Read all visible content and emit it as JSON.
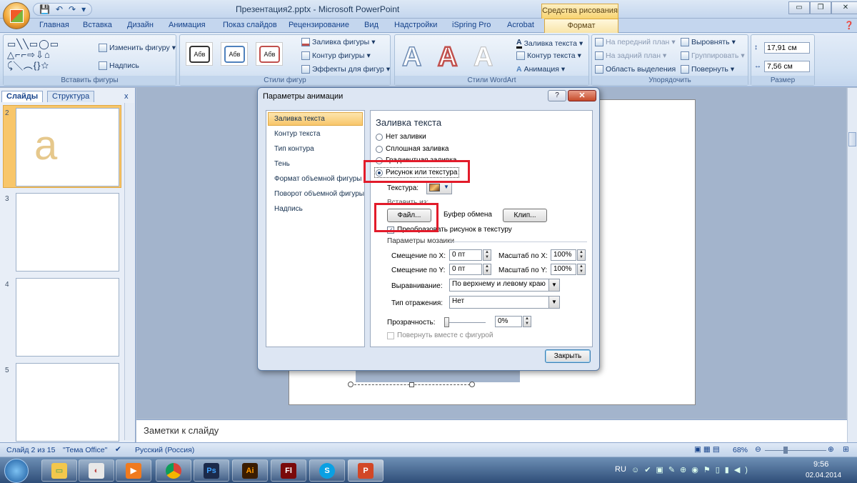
{
  "window": {
    "title": "Презентация2.pptx - Microsoft PowerPoint",
    "context_group": "Средства рисования",
    "controls": [
      "▭",
      "❐",
      "✕"
    ]
  },
  "qat": {
    "save": "💾",
    "undo": "↶",
    "redo": "↷",
    "more": "▾"
  },
  "ribbon_tabs": [
    "Главная",
    "Вставка",
    "Дизайн",
    "Анимация",
    "Показ слайдов",
    "Рецензирование",
    "Вид",
    "Надстройки",
    "iSpring Pro",
    "Acrobat"
  ],
  "active_tab": "Формат",
  "ribbon": {
    "insert_shapes": {
      "label": "Вставить фигуры",
      "change_shape": "Изменить фигуру",
      "text_box": "Надпись"
    },
    "shape_styles": {
      "label": "Стили фигур",
      "sample": "Абв",
      "fill": "Заливка фигуры",
      "outline": "Контур фигуры",
      "effects": "Эффекты для фигур"
    },
    "wordart": {
      "label": "Стили WordArt",
      "letter": "A",
      "text_fill": "Заливка текста",
      "text_outline": "Контур текста",
      "animation": "Анимация"
    },
    "arrange": {
      "label": "Упорядочить",
      "bring_front": "На передний план",
      "send_back": "На задний план",
      "selection_pane": "Область выделения",
      "align": "Выровнять",
      "group": "Группировать",
      "rotate": "Повернуть"
    },
    "size": {
      "label": "Размер",
      "height": "17,91 см",
      "width": "7,56 см"
    }
  },
  "left_panel": {
    "tabs": [
      "Слайды",
      "Структура"
    ],
    "close": "x",
    "slides": [
      {
        "num": "2",
        "content": "a"
      },
      {
        "num": "3",
        "content": ""
      },
      {
        "num": "4",
        "content": ""
      },
      {
        "num": "5",
        "content": ""
      }
    ]
  },
  "notes": {
    "placeholder": "Заметки к слайду"
  },
  "status": {
    "slide": "Слайд 2 из 15",
    "theme": "\"Тема Office\"",
    "language": "Русский (Россия)",
    "zoom": "68%"
  },
  "tray": {
    "lang": "RU",
    "time": "9:56",
    "date": "02.04.2014"
  },
  "taskbar": {
    "apps": [
      {
        "name": "ps",
        "text": "Ps",
        "color": "#1b2a4a",
        "fg": "#3fa2ff"
      },
      {
        "name": "ai",
        "text": "Ai",
        "color": "#3a1c00",
        "fg": "#ff9a00"
      },
      {
        "name": "flash",
        "text": "Fl",
        "color": "#7a0a0a",
        "fg": "#fff"
      },
      {
        "name": "skype",
        "text": "S",
        "color": "#0aa0e3",
        "fg": "#fff"
      },
      {
        "name": "ppt",
        "text": "P",
        "color": "#d24726",
        "fg": "#fff"
      }
    ]
  },
  "dialog": {
    "title": "Параметры анимации",
    "help": "?",
    "close": "✕",
    "nav": [
      "Заливка текста",
      "Контур текста",
      "Тип контура",
      "Тень",
      "Формат объемной фигуры",
      "Поворот объемной фигуры",
      "Надпись"
    ],
    "heading": "Заливка текста",
    "fill_options": [
      "Нет заливки",
      "Сплошная заливка",
      "Градиентная заливка",
      "Рисунок или текстура"
    ],
    "texture_label": "Текстура:",
    "insert_from": "Вставить из:",
    "file_btn": "Файл...",
    "clipboard_btn": "Буфер обмена",
    "clip_btn": "Клип...",
    "tile_check": "Преобразовать рисунок в текстуру",
    "tiling_header": "Параметры мозаики",
    "offset_x_label": "Смещение по X:",
    "offset_x": "0 пт",
    "offset_y_label": "Смещение по Y:",
    "offset_y": "0 пт",
    "scale_x_label": "Масштаб по X:",
    "scale_x": "100%",
    "scale_y_label": "Масштаб по Y:",
    "scale_y": "100%",
    "align_label": "Выравнивание:",
    "align_value": "По верхнему и левому краю",
    "mirror_label": "Тип отражения:",
    "mirror_value": "Нет",
    "transparency_label": "Прозрачность:",
    "transparency": "0%",
    "rotate_check": "Повернуть вместе с фигурой",
    "close_btn": "Закрыть"
  },
  "colors": {
    "selection": "#f8c66a",
    "highlight": "#e21b2a",
    "ribbon_bg": "#cfdff2"
  }
}
